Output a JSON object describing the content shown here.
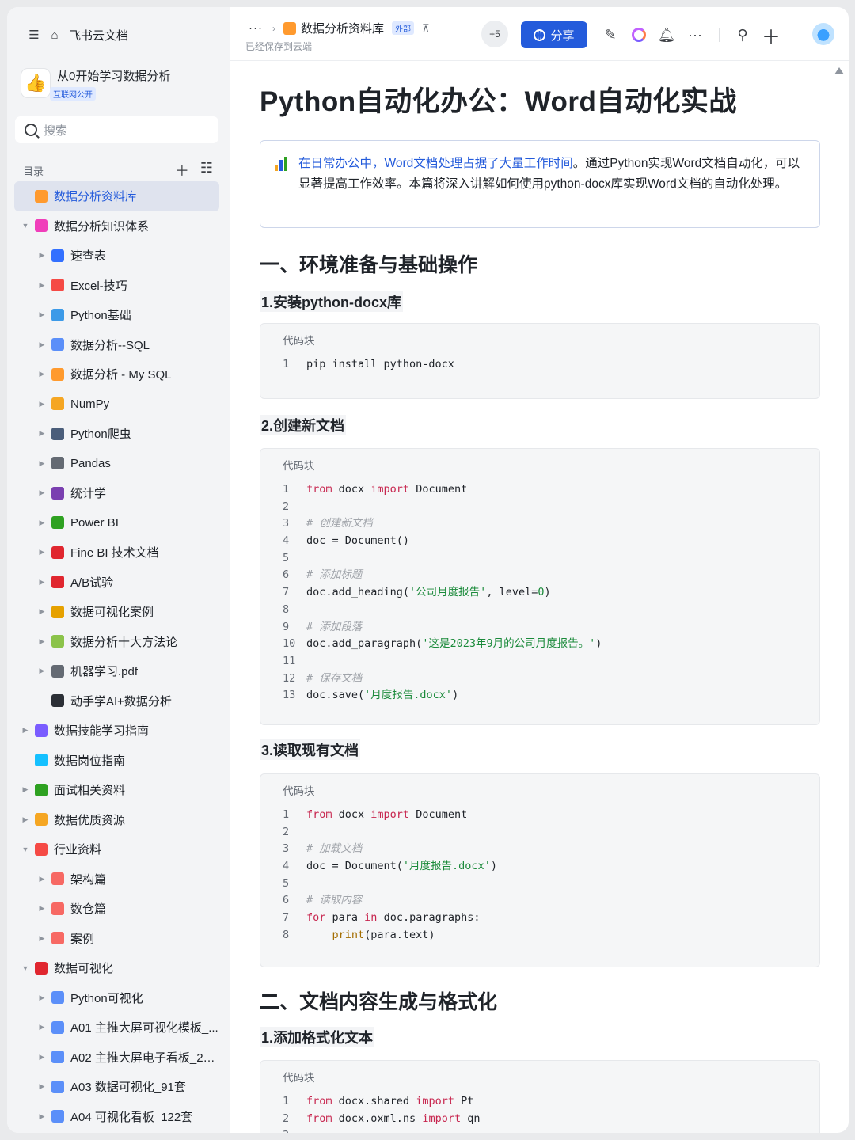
{
  "sidebar": {
    "app_title": "飞书云文档",
    "space_name": "从0开始学习数据分析",
    "space_tag": "互联网公开",
    "search_placeholder": "搜索",
    "toc_label": "目录",
    "items": [
      {
        "label": "数据分析资料库",
        "level": 0,
        "icon": "library-icon",
        "color": "#ff9a2e",
        "active": true,
        "arrow": ""
      },
      {
        "label": "数据分析知识体系",
        "level": 0,
        "icon": "book-icon",
        "color": "#f03eba",
        "arrow": "▼"
      },
      {
        "label": "速查表",
        "level": 1,
        "icon": "magnifier-icon",
        "color": "#3370ff",
        "arrow": "▶"
      },
      {
        "label": "Excel-技巧",
        "level": 1,
        "icon": "hundred-icon",
        "color": "#f54a45",
        "arrow": "▶"
      },
      {
        "label": "Python基础",
        "level": 1,
        "icon": "laptop-icon",
        "color": "#3c9ae8",
        "arrow": "▶"
      },
      {
        "label": "数据分析--SQL",
        "level": 1,
        "icon": "bar-chart-icon",
        "color": "#5b8ff9",
        "arrow": "▶"
      },
      {
        "label": "数据分析 - My SQL",
        "level": 1,
        "icon": "rainbow-icon",
        "color": "#ff9a2e",
        "arrow": "▶"
      },
      {
        "label": "NumPy",
        "level": 1,
        "icon": "memo-icon",
        "color": "#f5a623",
        "arrow": "▶"
      },
      {
        "label": "Python爬虫",
        "level": 1,
        "icon": "spider-icon",
        "color": "#4a5d7a",
        "arrow": "▶"
      },
      {
        "label": "Pandas",
        "level": 1,
        "icon": "panda-icon",
        "color": "#646a73",
        "arrow": "▶"
      },
      {
        "label": "统计学",
        "level": 1,
        "icon": "floppy-icon",
        "color": "#7a3fb0",
        "arrow": "▶"
      },
      {
        "label": "Power BI",
        "level": 1,
        "icon": "recycle-icon",
        "color": "#2ea121",
        "arrow": "▶"
      },
      {
        "label": "Fine BI 技术文档",
        "level": 1,
        "icon": "pushpin-icon",
        "color": "#e0262f",
        "arrow": "▶"
      },
      {
        "label": "A/B试验",
        "level": 1,
        "icon": "ab-icon",
        "color": "#e0262f",
        "arrow": "▶"
      },
      {
        "label": "数据可视化案例",
        "level": 1,
        "icon": "medal-icon",
        "color": "#e6a100",
        "arrow": "▶"
      },
      {
        "label": "数据分析十大方法论",
        "level": 1,
        "icon": "puzzle-icon",
        "color": "#8bc34a",
        "arrow": "▶"
      },
      {
        "label": "机器学习.pdf",
        "level": 1,
        "icon": "robot-icon",
        "color": "#646a73",
        "arrow": "▶"
      },
      {
        "label": "动手学AI+数据分析",
        "level": 1,
        "icon": "traffic-light-icon",
        "color": "#2b2f36",
        "arrow": ""
      },
      {
        "label": "数据技能学习指南",
        "level": 0,
        "icon": "guide-icon",
        "color": "#7a5cff",
        "arrow": "▶"
      },
      {
        "label": "数据岗位指南",
        "level": 0,
        "icon": "job-icon",
        "color": "#14c0ff",
        "arrow": ""
      },
      {
        "label": "面试相关资料",
        "level": 0,
        "icon": "interview-icon",
        "color": "#2ea121",
        "arrow": "▶"
      },
      {
        "label": "数据优质资源",
        "level": 0,
        "icon": "thumbs-up-icon",
        "color": "#f5a623",
        "arrow": "▶"
      },
      {
        "label": "行业资料",
        "level": 0,
        "icon": "sticker-icon",
        "color": "#f54a45",
        "arrow": "▼"
      },
      {
        "label": "架构篇",
        "level": 1,
        "icon": "architecture-icon",
        "color": "#f76964",
        "arrow": "▶"
      },
      {
        "label": "数仓篇",
        "level": 1,
        "icon": "warehouse-icon",
        "color": "#f76964",
        "arrow": "▶"
      },
      {
        "label": "案例",
        "level": 1,
        "icon": "case-icon",
        "color": "#f76964",
        "arrow": "▶"
      },
      {
        "label": "数据可视化",
        "level": 0,
        "icon": "rocket-icon",
        "color": "#e0262f",
        "arrow": "▼"
      },
      {
        "label": "Python可视化",
        "level": 1,
        "icon": "bar-chart-icon",
        "color": "#5b8ff9",
        "arrow": "▶"
      },
      {
        "label": "A01 主推大屏可视化模板_...",
        "level": 1,
        "icon": "bar-chart-icon",
        "color": "#5b8ff9",
        "arrow": "▶"
      },
      {
        "label": "A02 主推大屏电子看板_20套",
        "level": 1,
        "icon": "bar-chart-icon",
        "color": "#5b8ff9",
        "arrow": "▶"
      },
      {
        "label": "A03 数据可视化_91套",
        "level": 1,
        "icon": "bar-chart-icon",
        "color": "#5b8ff9",
        "arrow": "▶"
      },
      {
        "label": "A04 可视化看板_122套",
        "level": 1,
        "icon": "bar-chart-icon",
        "color": "#5b8ff9",
        "arrow": "▶"
      }
    ]
  },
  "header": {
    "more": "···",
    "breadcrumb_library": "数据分析资料库",
    "external_tag": "外部",
    "saved_status": "已经保存到云端",
    "collaborators_more": "+5",
    "share_label": "分享",
    "more_actions": "···"
  },
  "doc": {
    "title": "Python自动化办公：Word自动化实战",
    "callout_highlight": "在日常办公中，Word文档处理占据了大量工作时间",
    "callout_rest": "。通过Python实现Word文档自动化，可以显著提高工作效率。本篇将深入讲解如何使用python-docx库实现Word文档的自动化处理。",
    "section1_title": "一、环境准备与基础操作",
    "sub1_1": "1.安装python-docx库",
    "sub1_2": "2.创建新文档",
    "sub1_3": "3.读取现有文档",
    "section2_title": "二、文档内容生成与格式化",
    "sub2_1": "1.添加格式化文本",
    "code_caption": "代码块"
  },
  "code_blocks": [
    {
      "lines": [
        [
          [
            "t",
            "pip install python-docx"
          ]
        ]
      ]
    },
    {
      "lines": [
        [
          [
            "kw",
            "from"
          ],
          [
            "t",
            " docx "
          ],
          [
            "kw",
            "import"
          ],
          [
            "t",
            " Document"
          ]
        ],
        [],
        [
          [
            "cm",
            "# 创建新文档"
          ]
        ],
        [
          [
            "t",
            "doc = Document()"
          ]
        ],
        [],
        [
          [
            "cm",
            "# 添加标题"
          ]
        ],
        [
          [
            "t",
            "doc.add_heading("
          ],
          [
            "st",
            "'公司月度报告'"
          ],
          [
            "t",
            ", level="
          ],
          [
            "st",
            "0"
          ],
          [
            "t",
            ")"
          ]
        ],
        [],
        [
          [
            "cm",
            "# 添加段落"
          ]
        ],
        [
          [
            "t",
            "doc.add_paragraph("
          ],
          [
            "st",
            "'这是2023年9月的公司月度报告。'"
          ],
          [
            "t",
            ")"
          ]
        ],
        [],
        [
          [
            "cm",
            "# 保存文档"
          ]
        ],
        [
          [
            "t",
            "doc.save("
          ],
          [
            "st",
            "'月度报告.docx'"
          ],
          [
            "t",
            ")"
          ]
        ]
      ]
    },
    {
      "lines": [
        [
          [
            "kw",
            "from"
          ],
          [
            "t",
            " docx "
          ],
          [
            "kw",
            "import"
          ],
          [
            "t",
            " Document"
          ]
        ],
        [],
        [
          [
            "cm",
            "# 加载文档"
          ]
        ],
        [
          [
            "t",
            "doc = Document("
          ],
          [
            "st",
            "'月度报告.docx'"
          ],
          [
            "t",
            ")"
          ]
        ],
        [],
        [
          [
            "cm",
            "# 读取内容"
          ]
        ],
        [
          [
            "kw",
            "for"
          ],
          [
            "t",
            " para "
          ],
          [
            "kw",
            "in"
          ],
          [
            "t",
            " doc.paragraphs:"
          ]
        ],
        [
          [
            "t",
            "    "
          ],
          [
            "fn",
            "print"
          ],
          [
            "t",
            "(para.text)"
          ]
        ]
      ]
    },
    {
      "lines": [
        [
          [
            "kw",
            "from"
          ],
          [
            "t",
            " docx.shared "
          ],
          [
            "kw",
            "import"
          ],
          [
            "t",
            " Pt"
          ]
        ],
        [
          [
            "kw",
            "from"
          ],
          [
            "t",
            " docx.oxml.ns "
          ],
          [
            "kw",
            "import"
          ],
          [
            "t",
            " qn"
          ]
        ],
        []
      ]
    }
  ]
}
